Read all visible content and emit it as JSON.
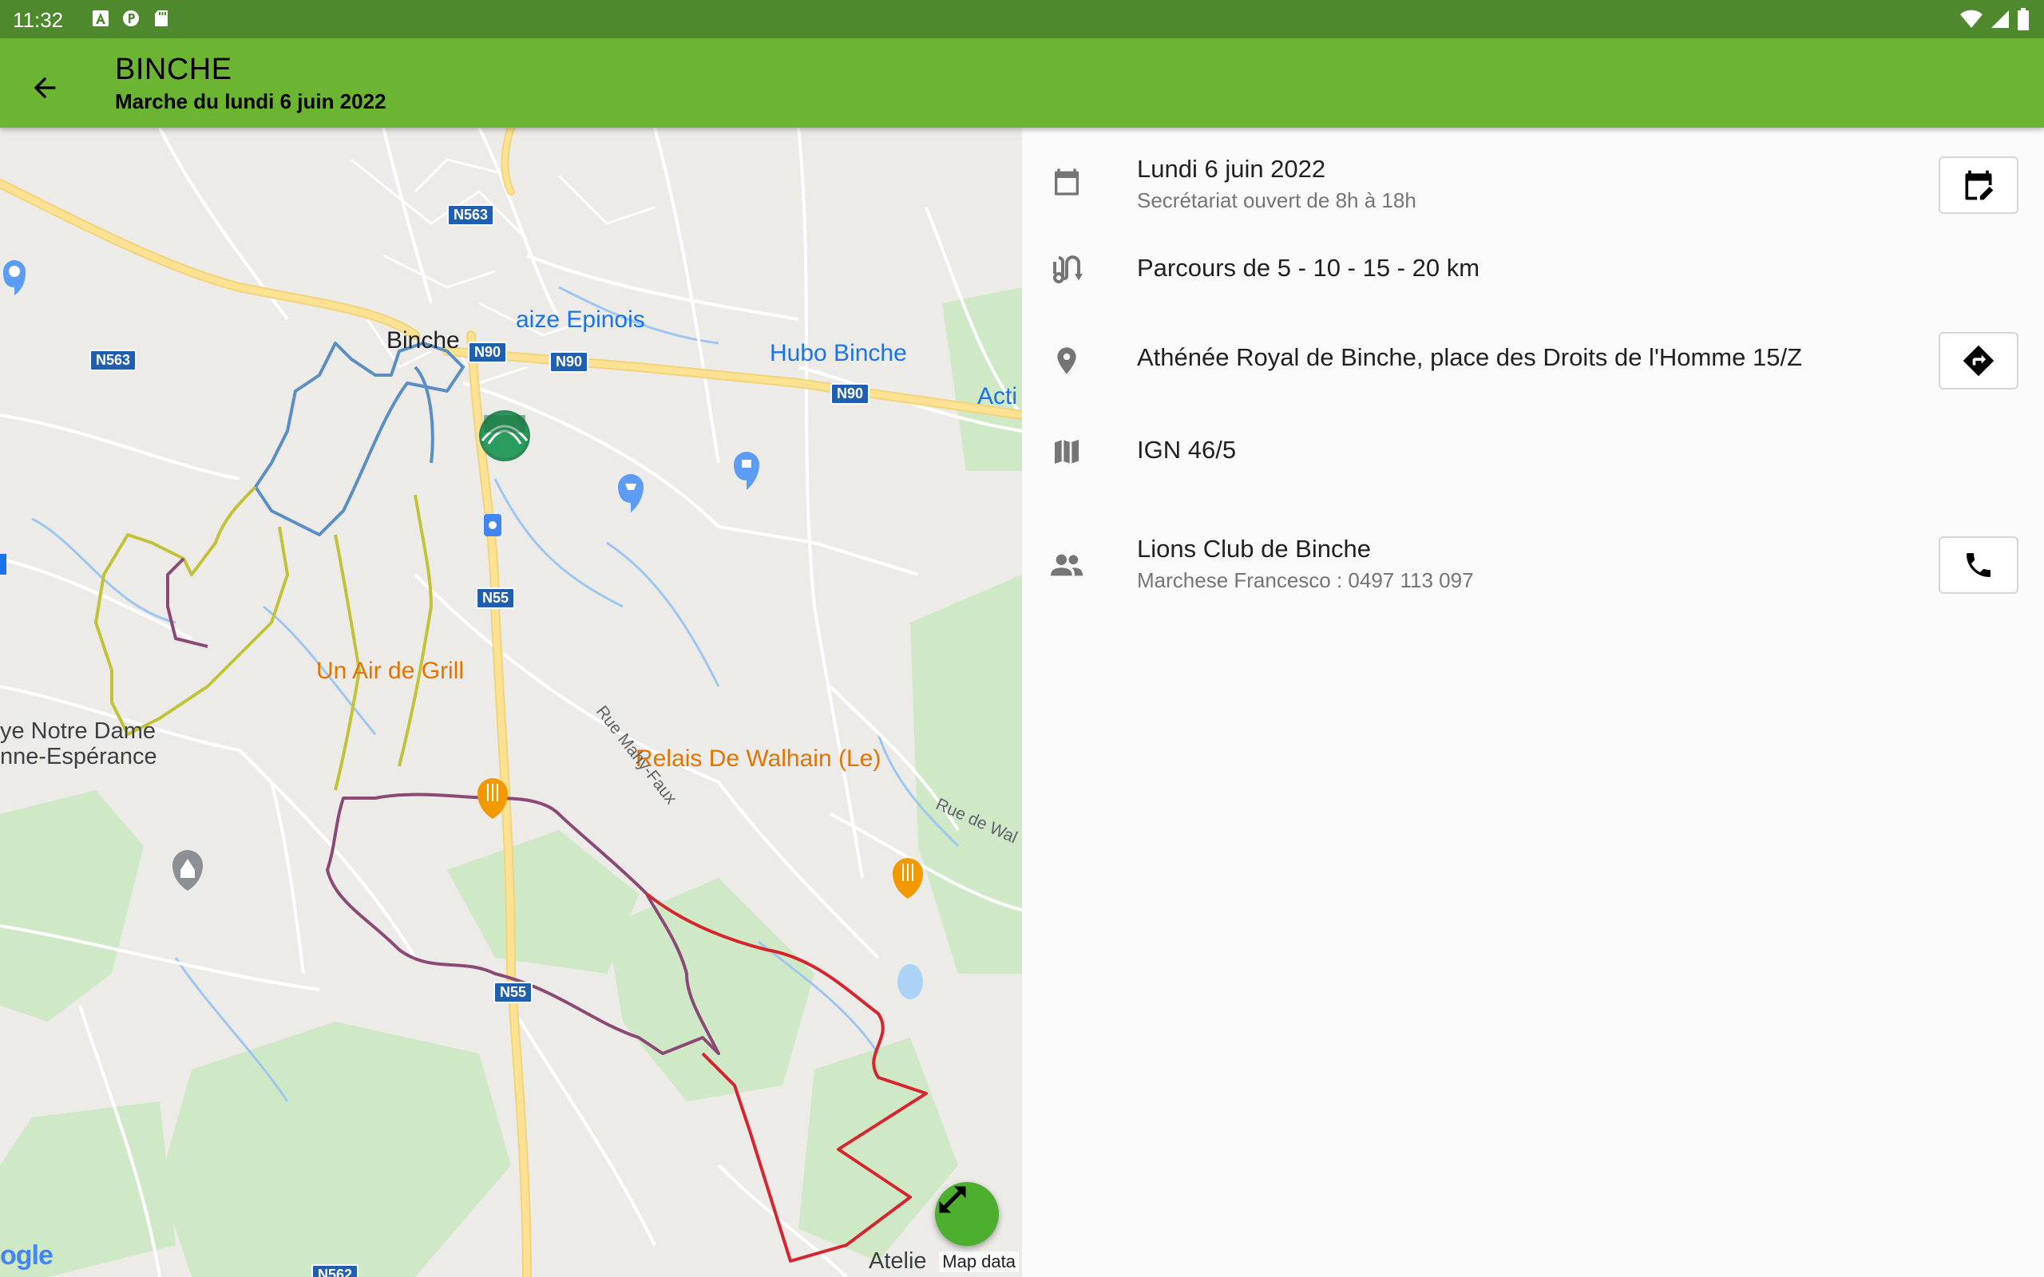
{
  "status_bar": {
    "time": "11:32",
    "left_icons": [
      "a-notification-icon",
      "p-notification-icon",
      "sd-card-icon"
    ],
    "right_icons": [
      "wifi-icon",
      "signal-icon",
      "battery-icon"
    ]
  },
  "app_bar": {
    "title": "BINCHE",
    "subtitle": "Marche du lundi 6 juin 2022",
    "back_icon": "arrow-back-icon",
    "color": "#6bb532"
  },
  "map": {
    "places": {
      "binche": "Binche",
      "epinois": "aize Epinois",
      "hubo": "Hubo Binche",
      "acti": "Acti",
      "grill": "Un Air de Grill",
      "relais": "Relais De Walhain (Le)",
      "abbaye_1": "ye Notre Dame",
      "abbaye_2": "nne-Espérance",
      "atelier": "Atelie"
    },
    "roads": {
      "n563_top": "N563",
      "n563_left": "N563",
      "n90_a": "N90",
      "n90_b": "N90",
      "n90_c": "N90",
      "n55_a": "N55",
      "n55_b": "N55",
      "n562": "N562"
    },
    "streets": {
      "mahy_faux": "Rue Mahy-Faux",
      "walhain": "Rue de Wal"
    },
    "google": "ogle",
    "attribution": "Map data",
    "fab_icon": "expand-icon",
    "route_colors": [
      "#5b8ec2",
      "#c2c238",
      "#8b4a76",
      "#d6252e"
    ]
  },
  "details": {
    "date": {
      "icon": "calendar-icon",
      "primary": "Lundi 6 juin 2022",
      "secondary": "Secrétariat ouvert de 8h à 18h",
      "action_icon": "calendar-edit-icon"
    },
    "distances": {
      "icon": "route-icon",
      "primary": "Parcours de 5 - 10 - 15 - 20 km"
    },
    "location": {
      "icon": "location-pin-icon",
      "primary": "Athénée Royal de Binche, place des Droits de l'Homme 15/Z",
      "action_icon": "directions-icon"
    },
    "map_ref": {
      "icon": "map-icon",
      "primary": "IGN 46/5"
    },
    "organizer": {
      "icon": "people-icon",
      "primary": "Lions Club de Binche",
      "secondary": "Marchese Francesco : 0497 113 097",
      "action_icon": "phone-icon"
    }
  }
}
